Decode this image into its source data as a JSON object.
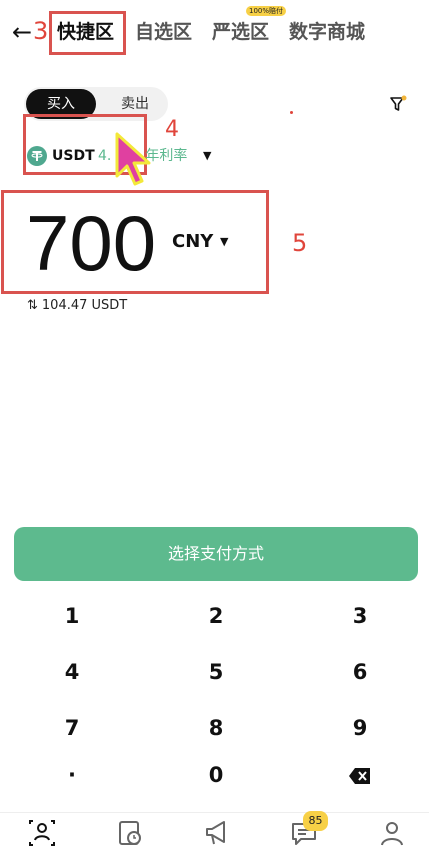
{
  "nav": {
    "back_glyph": "←",
    "tabs": [
      {
        "label": "快捷区",
        "active": true
      },
      {
        "label": "自选区",
        "active": false
      },
      {
        "label": "严选区",
        "active": false,
        "badge": "100%赔付"
      },
      {
        "label": "数字商城",
        "active": false
      }
    ]
  },
  "annotations": {
    "n3": "3",
    "n4": "4",
    "n5": "5"
  },
  "trade": {
    "buy_label": "买入",
    "sell_label": "卖出"
  },
  "coin": {
    "name": "USDT",
    "rate_text": "4.",
    "rate_suffix": "年利率",
    "icon": "tether-icon"
  },
  "amount": {
    "value": "700",
    "currency": "CNY",
    "converted": "104.47 USDT"
  },
  "pay_button": "选择支付方式",
  "keypad": [
    "1",
    "2",
    "3",
    "4",
    "5",
    "6",
    "7",
    "8",
    "9",
    "·",
    "0",
    "⌫"
  ],
  "bottom_nav": {
    "messages_badge": "85"
  },
  "colors": {
    "accent": "#5dba8e",
    "annotation": "#d9534f",
    "badge": "#f7d046"
  }
}
